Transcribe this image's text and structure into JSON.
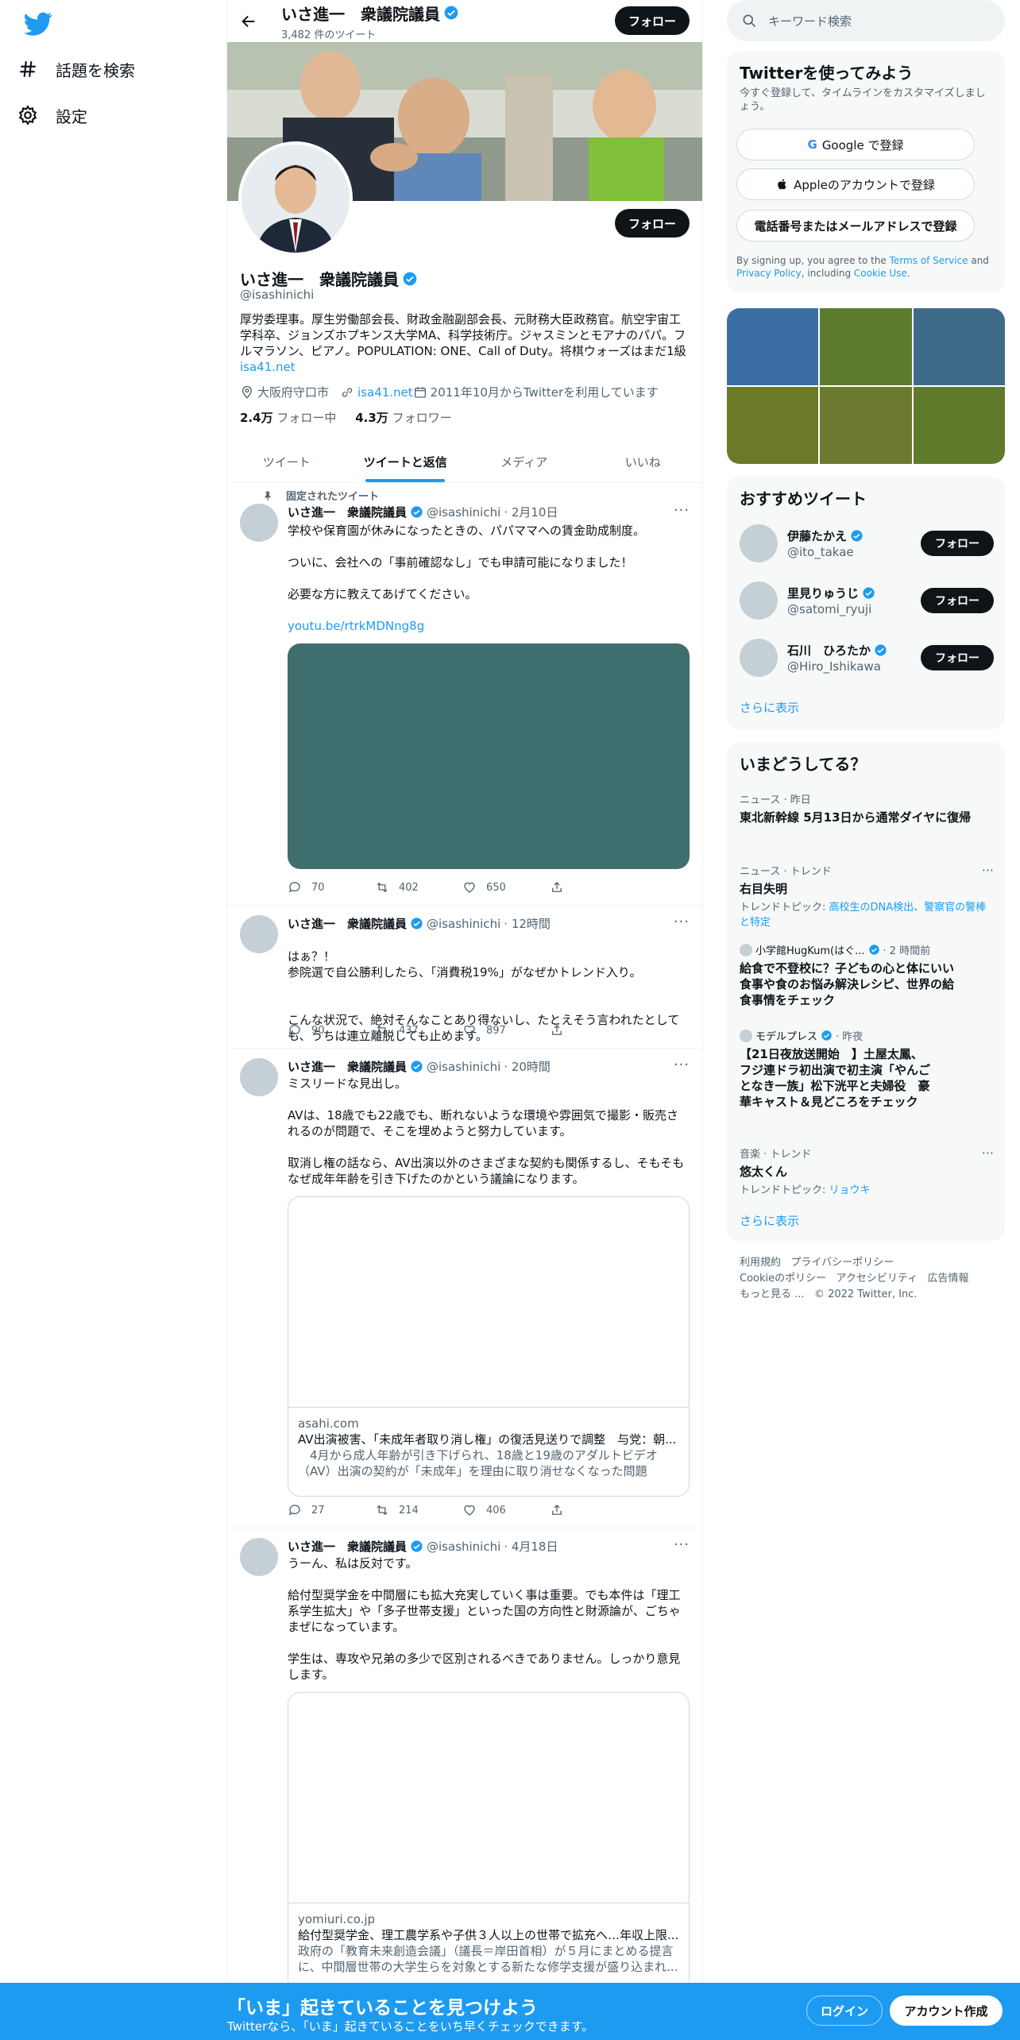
{
  "nav": {
    "explore_label": "話題を検索",
    "settings_label": "設定"
  },
  "header": {
    "name": "いさ進一　衆議院議員",
    "tweet_count": "3,482 件のツイート",
    "follow_label": "フォロー"
  },
  "profile": {
    "name": "いさ進一　衆議院議員",
    "handle": "@isashinichi",
    "bio": "厚労委理事。厚生労働部会長、財政金融副部会長、元財務大臣政務官。航空宇宙工学科卒、ジョンズホプキンス大学MA、科学技術庁。ジャスミンとモアナのパパ。フルマラソン、ピアノ。POPULATION: ONE、Call of Duty。将棋ウォーズはまだ1級",
    "bio_link": "isa41.net",
    "location": "大阪府守口市",
    "website": "isa41.net",
    "joined": "2011年10月からTwitterを利用しています",
    "following_count": "2.4万",
    "following_label": "フォロー中",
    "followers_count": "4.3万",
    "followers_label": "フォロワー",
    "follow_label": "フォロー"
  },
  "tabs": [
    {
      "label": "ツイート"
    },
    {
      "label": "ツイートと返信"
    },
    {
      "label": "メディア"
    },
    {
      "label": "いいね"
    }
  ],
  "tweets": [
    {
      "pinned_label": "固定されたツイート",
      "name": "いさ進一　衆議院議員",
      "handle": "@isashinichi",
      "time": "· 2月10日",
      "paragraphs": [
        "学校や保育園が休みになったときの、パパママへの賃金助成制度。",
        "ついに、会社への「事前確認なし」でも申請可能になりました！",
        "必要な方に教えてあげてください。"
      ],
      "link": "youtu.be/rtrkMDNng8g",
      "media_color": "#3f6e6e",
      "replies": "70",
      "retweets": "402",
      "likes": "650"
    },
    {
      "name": "いさ進一　衆議院議員",
      "handle": "@isashinichi",
      "time": "· 12時間",
      "paragraphs": [
        "はぁ？！\n参院選で自公勝利したら、「消費税19%」がなぜかトレンド入り。",
        "こんな状況で、絶対そんなことあり得ないし、たとえそう言われたとしても、うちは連立離脱しても止めます。"
      ],
      "replies": "90",
      "retweets": "437",
      "likes": "897"
    },
    {
      "name": "いさ進一　衆議院議員",
      "handle": "@isashinichi",
      "time": "· 20時間",
      "paragraphs": [
        "ミスリードな見出し。",
        "AVは、18歳でも22歳でも、断れないような環境や雰囲気で撮影・販売されるのが問題で、そこを埋めようと努力しています。",
        "取消し権の話なら、AV出演以外のさまざまな契約も関係するし、そもそもなぜ成年年齢を引き下げたのかという議論になります。"
      ],
      "card": {
        "domain": "asahi.com",
        "title": "AV出演被害、「未成年者取り消し権」の復活見送りで調整　与党：朝...",
        "desc": "　4月から成人年齢が引き下げられ、18歳と19歳のアダルトビデオ（AV）出演の契約が「未成年」を理由に取り消せなくなった問題で、..."
      },
      "replies": "27",
      "retweets": "214",
      "likes": "406"
    },
    {
      "name": "いさ進一　衆議院議員",
      "handle": "@isashinichi",
      "time": "· 4月18日",
      "paragraphs": [
        "うーん、私は反対です。",
        "給付型奨学金を中間層にも拡大充実していく事は重要。でも本件は「理工系学生拡大」や「多子世帯支援」といった国の方向性と財源論が、ごちゃまぜになっています。",
        "学生は、専攻や兄弟の多少で区別されるべきでありません。しっかり意見します。"
      ],
      "card": {
        "domain": "yomiuri.co.jp",
        "title": "給付型奨学金、理工農学系や子供３人以上の世帯で拡充へ…年収上限...",
        "desc": "政府の「教育未来創造会議」（議長＝岸田首相）が５月にまとめる提言に、中間層世帯の大学生らを対象とする新たな修学支援が盛り込まれ..."
      }
    }
  ],
  "search": {
    "placeholder": "キーワード検索"
  },
  "signup_panel": {
    "title": "Twitterを使ってみよう",
    "subtitle": "今すぐ登録して、タイムラインをカスタマイズしましょう。",
    "google_label": "Google で登録",
    "apple_label": "Appleのアカウントで登録",
    "phone_label": "電話番号またはメールアドレスで登録",
    "terms_prefix": "By signing up, you agree to the ",
    "terms_link": "Terms of Service",
    "terms_and": " and ",
    "privacy_link": "Privacy Policy",
    "terms_including": ", including ",
    "cookie_link": "Cookie Use",
    "terms_end": "."
  },
  "photo_grid_colors": [
    "#3b6ea5",
    "#5d7a2e",
    "#3f6b8a",
    "#6a7a27",
    "#6b7a30",
    "#5f7a2a"
  ],
  "suggestions": {
    "title": "おすすめツイート",
    "items": [
      {
        "name": "伊藤たかえ",
        "handle": "@ito_takae",
        "follow_label": "フォロー"
      },
      {
        "name": "里見りゅうじ",
        "handle": "@satomi_ryuji",
        "follow_label": "フォロー"
      },
      {
        "name": "石川　ひろたか",
        "handle": "@Hiro_Ishikawa",
        "follow_label": "フォロー"
      }
    ],
    "show_more": "さらに表示"
  },
  "trends": {
    "title": "いまどうしてる？",
    "items": [
      {
        "context": "ニュース · 昨日",
        "name": "東北新幹線 5月13日から通常ダイヤに復帰"
      },
      {
        "context": "ニュース · トレンド",
        "name": "右目失明",
        "topic_label": "トレンドトピック: ",
        "topic": "高校生のDNA検出、警察官の警棒と特定"
      },
      {
        "source": "小学館HugKum(はぐ...",
        "time": "· 2 時間前",
        "name": "給食で不登校に？子どもの心と体にいい食事や食のお悩み解決レシピ、世界の給食事情をチェック"
      },
      {
        "source": "モデルプレス",
        "time": "· 昨夜",
        "name": "【21日夜放送開始　】土屋太鳳、フジ連ドラ初出演で初主演「やんごとなき一族」松下洸平と夫婦役　豪華キャスト＆見どころをチェック"
      },
      {
        "context": "音楽 · トレンド",
        "name": "悠太くん",
        "topic_label": "トレンドトピック: ",
        "topic": "リョウキ"
      }
    ],
    "show_more": "さらに表示"
  },
  "footer": {
    "links": [
      "利用規約",
      "プライバシーポリシー",
      "Cookieのポリシー",
      "アクセシビリティ",
      "広告情報",
      "もっと見る ..."
    ],
    "copyright": "© 2022 Twitter, Inc."
  },
  "bottom_bar": {
    "title": "「いま」起きていることを見つけよう",
    "subtitle": "Twitterなら、「いま」起きていることをいち早くチェックできます。",
    "login_label": "ログイン",
    "signup_label": "アカウント作成"
  }
}
